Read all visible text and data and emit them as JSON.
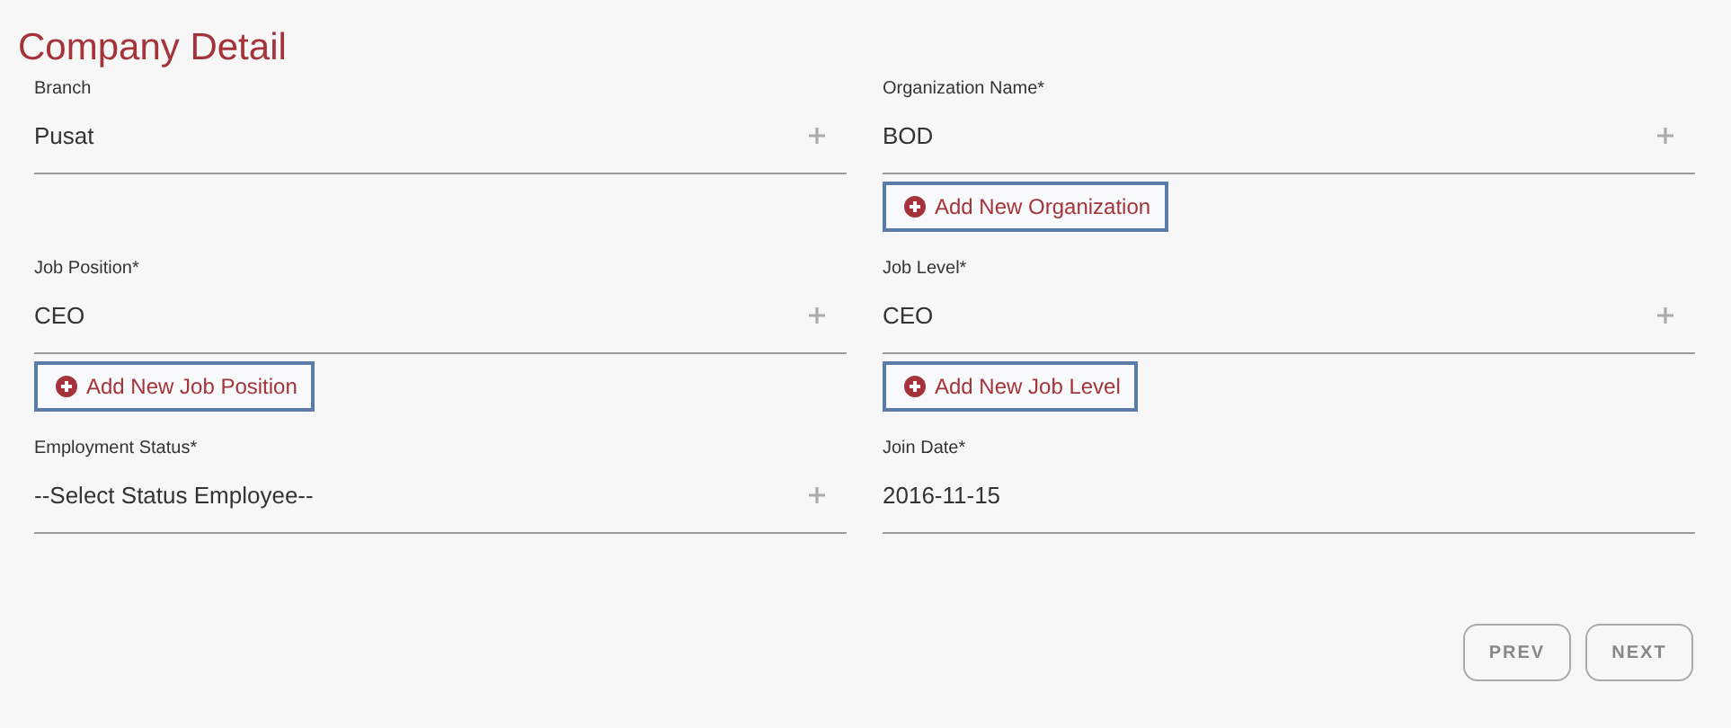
{
  "title": "Company Detail",
  "fields": [
    {
      "label": "Branch",
      "value": "Pusat",
      "kind": "select"
    },
    {
      "label": "Organization Name*",
      "value": "BOD",
      "kind": "select",
      "add_button": "Add New Organization"
    },
    {
      "label": "Job Position*",
      "value": "CEO",
      "kind": "select",
      "add_button": "Add New Job Position"
    },
    {
      "label": "Job Level*",
      "value": "CEO",
      "kind": "select",
      "add_button": "Add New Job Level"
    },
    {
      "label": "Employment Status*",
      "value": "--Select Status Employee--",
      "kind": "select"
    },
    {
      "label": "Join Date*",
      "value": "2016-11-15",
      "kind": "date"
    }
  ],
  "buttons": [
    "PREV",
    "NEXT"
  ]
}
